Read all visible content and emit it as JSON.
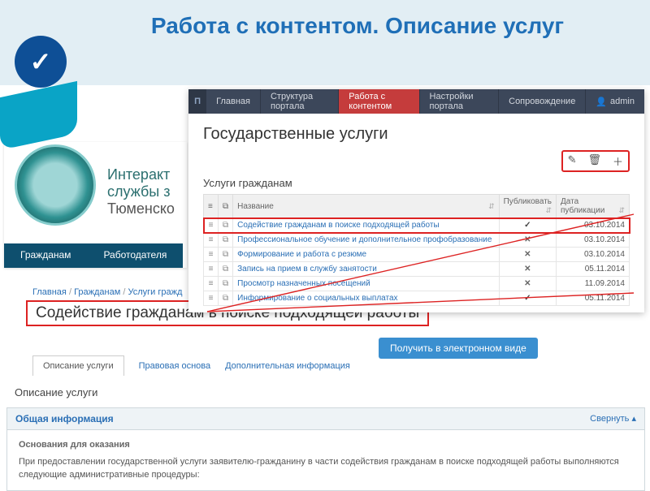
{
  "slide": {
    "title": "Работа с контентом. Описание услуг"
  },
  "bg": {
    "line1": "Интеракт",
    "line2": "службы з",
    "line3": "Тюменско",
    "tabs": [
      "Гражданам",
      "Работодателя"
    ]
  },
  "admin": {
    "logo": "П",
    "nav": [
      "Главная",
      "Структура портала",
      "Работа с контентом",
      "Настройки портала",
      "Сопровождение"
    ],
    "active_index": 2,
    "user_label": "admin",
    "h1": "Государственные услуги",
    "toolbar": {
      "edit": "✎",
      "delete": "🗑",
      "add": "＋"
    },
    "sub_h": "Услуги гражданам",
    "columns": {
      "name": "Название",
      "publish": "Публиковать",
      "date": "Дата публикации"
    },
    "rows": [
      {
        "name": "Содействие гражданам в поиске подходящей работы",
        "publish": true,
        "date": "03.10.2014",
        "hl": true
      },
      {
        "name": "Профессиональное обучение и дополнительное профобразование",
        "publish": false,
        "date": "03.10.2014"
      },
      {
        "name": "Формирование и работа с резюме",
        "publish": false,
        "date": "03.10.2014"
      },
      {
        "name": "Запись на прием в службу занятости",
        "publish": false,
        "date": "05.11.2014"
      },
      {
        "name": "Просмотр назначенных посещений",
        "publish": false,
        "date": "11.09.2014"
      },
      {
        "name": "Информирование о социальных выплатах",
        "publish": true,
        "date": "05.11.2014"
      }
    ]
  },
  "breadcrumb": {
    "items": [
      "Главная",
      "Гражданам",
      "Услуги гражд"
    ]
  },
  "main_title": "Содействие гражданам в поиске подходящей работы",
  "e_button": "Получить в электронном виде",
  "tabs": {
    "items": [
      "Описание услуги",
      "Правовая основа",
      "Дополнительная информация"
    ],
    "active": 0
  },
  "desc_h": "Описание услуги",
  "panel": {
    "title": "Общая информация",
    "collapse": "Свернуть ▴",
    "sub_h": "Основания для оказания",
    "text": "При предоставлении государственной услуги заявителю-гражданину в части содействия гражданам в поиске подходящей работы выполняются следующие административные процедуры:"
  }
}
